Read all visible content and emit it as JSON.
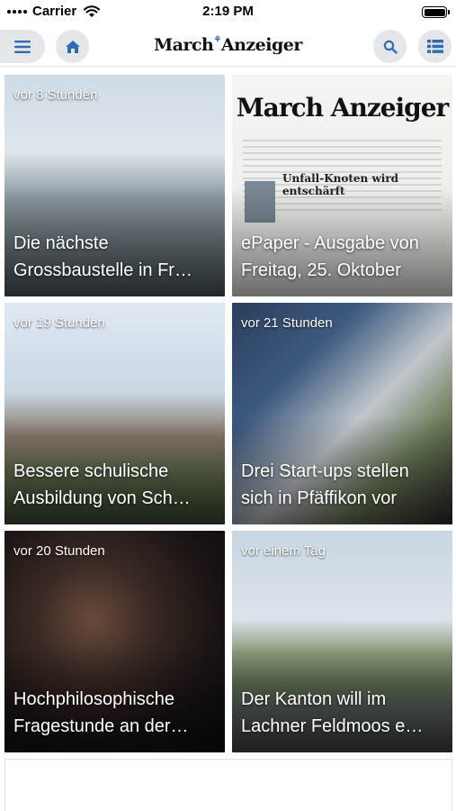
{
  "status": {
    "carrier": "Carrier",
    "time": "2:19 PM"
  },
  "nav": {
    "logo": "March Anzeiger",
    "logo_mark": "⚘"
  },
  "articles": [
    {
      "time": "vor 8 Stunden",
      "title": "Die nächste Grossbaustelle in Fr…"
    },
    {
      "time": "",
      "title": "ePaper - Ausgabe von Freitag, 25. Oktober",
      "masthead": "March Anzeiger",
      "headline": "Unfall-Knoten wird entschärft"
    },
    {
      "time": "vor 19 Stunden",
      "title": "Bessere schulische Ausbildung von Sch…"
    },
    {
      "time": "vor 21 Stunden",
      "title": "Drei Start-ups stellen sich in Pfäffikon vor"
    },
    {
      "time": "vor 20 Stunden",
      "title": "Hochphilosophische Fragestunde an der…"
    },
    {
      "time": "vor einem Tag",
      "title": "Der Kanton will im Lachner Feldmoos e…"
    }
  ],
  "colors": {
    "nav_button_bg": "#e4e6ea",
    "icon_blue": "#2f6db3"
  }
}
